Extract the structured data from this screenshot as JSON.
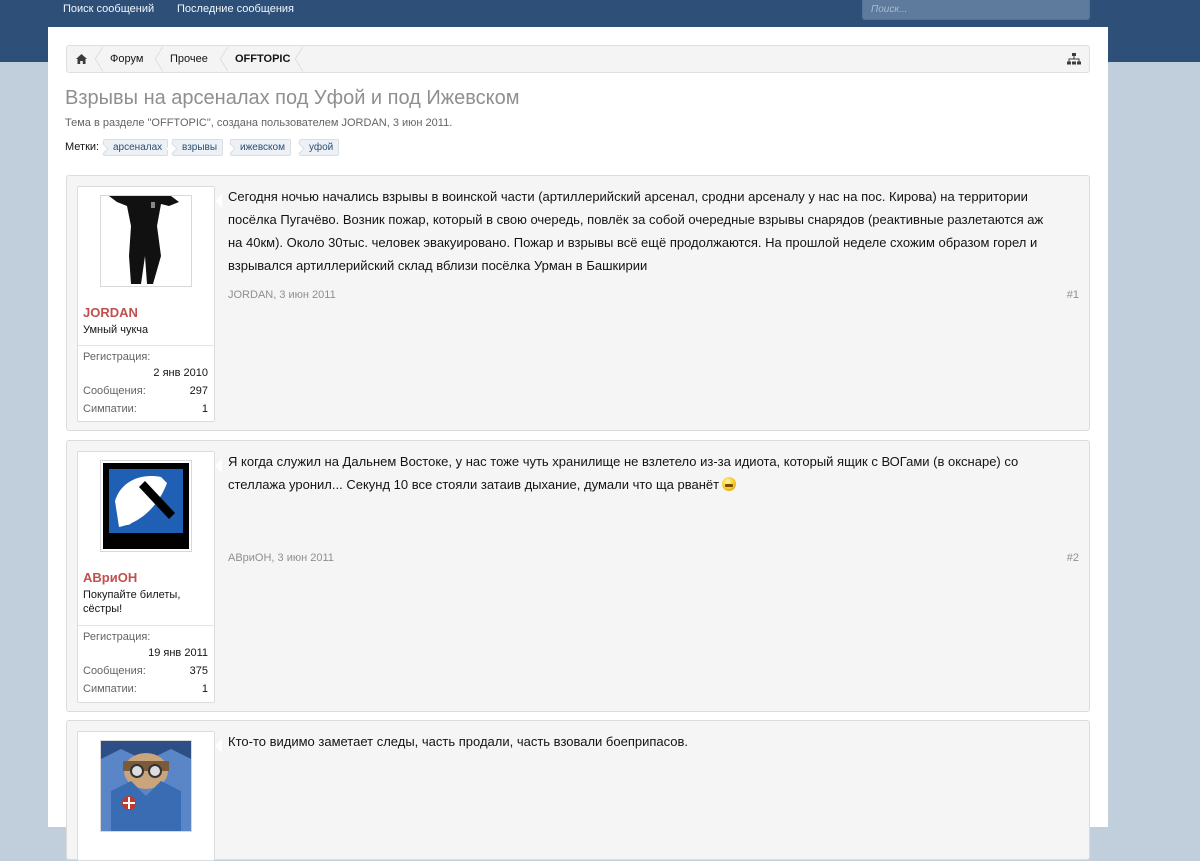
{
  "nav": {
    "links": [
      "Поиск сообщений",
      "Последние сообщения"
    ],
    "search_placeholder": "Поиск..."
  },
  "breadcrumb": {
    "items": [
      "Форум",
      "Прочее",
      "OFFTOPIC"
    ]
  },
  "thread": {
    "title": "Взрывы на арсеналах под Уфой и под Ижевском",
    "description": "Тема в разделе \"OFFTOPIC\", создана пользователем JORDAN, 3 июн 2011.",
    "tags_label": "Метки:",
    "tags": [
      "арсеналах",
      "взрывы",
      "ижевском",
      "уфой"
    ]
  },
  "labels": {
    "registration": "Регистрация:",
    "messages": "Сообщения:",
    "likes": "Симпатии:"
  },
  "posts": [
    {
      "user": "JORDAN",
      "user_title": "Умный чукча",
      "registered": "2 янв 2010",
      "messages": "297",
      "likes": "1",
      "text": "Сегодня ночью начались взрывы в воинской части (артиллерийский арсенал, сродни арсеналу у нас на пос. Кирова) на территории посёлка Пугачёво. Возник пожар, который в свою очередь, повлёк за собой очередные взрывы снарядов (реактивные разлетаются аж на 40км). Около 30тыс. человек эвакуировано. Пожар и взрывы всё ещё продолжаются. На прошлой неделе схожим образом горел и взрывался артиллерийский склад вблизи посёлка Урман в Башкирии",
      "meta": "JORDAN, 3 июн 2011",
      "num": "#1"
    },
    {
      "user": "АВриОН",
      "user_title": "Покупайте билеты, сёстры!",
      "registered": "19 янв 2011",
      "messages": "375",
      "likes": "1",
      "text": "Я когда служил на Дальнем Востоке, у нас тоже чуть хранилище не взлетело из-за идиота, который ящик с ВОГами (в окснаре) со стеллажа уронил... Секунд 10 все стояли затаив дыхание, думали что ща рванёт",
      "meta": "АВриОН, 3 июн 2011",
      "num": "#2"
    },
    {
      "text": "Кто-то видимо заметает следы, часть продали, часть взовали боеприпасов."
    }
  ]
}
